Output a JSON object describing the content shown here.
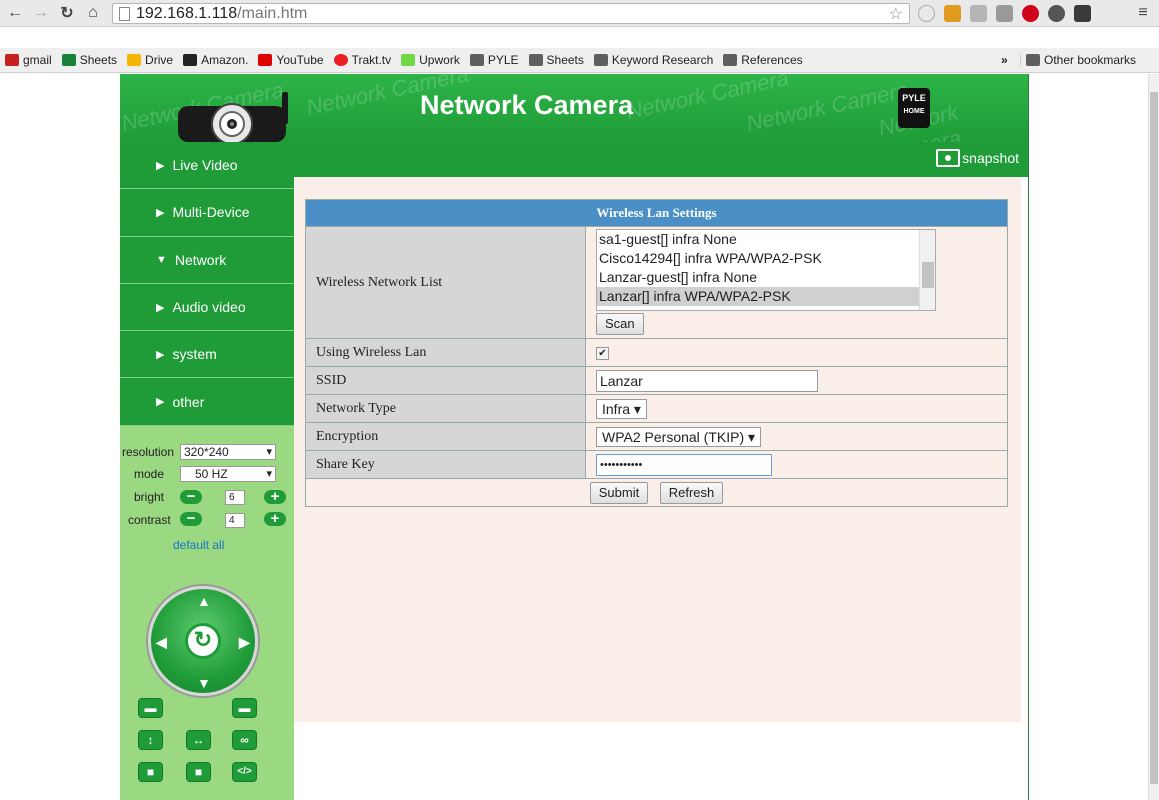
{
  "browser": {
    "url_host": "192.168.1.118",
    "url_path": "/main.htm",
    "bookmarks": [
      {
        "label": "gmail",
        "icon": "gmail-icon",
        "color": "#c5221f"
      },
      {
        "label": "Sheets",
        "icon": "sheets-icon",
        "color": "#188038"
      },
      {
        "label": "Drive",
        "icon": "drive-icon",
        "color": "#f4b400"
      },
      {
        "label": "Amazon.",
        "icon": "amazon-icon",
        "color": "#222222"
      },
      {
        "label": "YouTube",
        "icon": "youtube-icon",
        "color": "#e00000"
      },
      {
        "label": "Trakt.tv",
        "icon": "trakt-icon",
        "color": "#ed1c24"
      },
      {
        "label": "Upwork",
        "icon": "upwork-icon",
        "color": "#6fda44"
      },
      {
        "label": "PYLE",
        "icon": "folder-icon",
        "color": "#5f5f5f"
      },
      {
        "label": "Sheets",
        "icon": "folder-icon",
        "color": "#5f5f5f"
      },
      {
        "label": "Keyword Research",
        "icon": "folder-icon",
        "color": "#5f5f5f"
      },
      {
        "label": "References",
        "icon": "folder-icon",
        "color": "#5f5f5f"
      }
    ],
    "overflow": "»",
    "other_bookmarks": "Other bookmarks"
  },
  "banner": {
    "title": "Network Camera",
    "watermark": "Network Camera",
    "brand": "PYLE",
    "brand_sub": "HOME"
  },
  "menu": [
    {
      "label": "Live Video",
      "arrow": "▶"
    },
    {
      "label": "Multi-Device",
      "arrow": "▶"
    },
    {
      "label": "Network",
      "arrow": "▼"
    },
    {
      "label": "Audio video",
      "arrow": "▶"
    },
    {
      "label": "system",
      "arrow": "▶"
    },
    {
      "label": "other",
      "arrow": "▶"
    }
  ],
  "snapshot_label": "snapshot",
  "controls": {
    "resolution_label": "resolution",
    "resolution_value": "320*240",
    "mode_label": "mode",
    "mode_value": "50 HZ",
    "bright_label": "bright",
    "bright_value": "6",
    "contrast_label": "contrast",
    "contrast_value": "4",
    "default_all": "default all"
  },
  "wifi": {
    "header": "Wireless Lan Settings",
    "network_list_label": "Wireless Network List",
    "networks": [
      "sa1-guest[] infra None",
      "Cisco14294[] infra WPA/WPA2-PSK",
      "Lanzar-guest[] infra None",
      "Lanzar[] infra WPA/WPA2-PSK"
    ],
    "selected_network_index": 3,
    "scan_label": "Scan",
    "using_label": "Using Wireless Lan",
    "using_checked": "✔",
    "ssid_label": "SSID",
    "ssid_value": "Lanzar",
    "network_type_label": "Network Type",
    "network_type_value": "Infra",
    "encryption_label": "Encryption",
    "encryption_value": "WPA2 Personal (TKIP)",
    "share_key_label": "Share Key",
    "share_key_value": "•••••••••••",
    "submit_label": "Submit",
    "refresh_label": "Refresh"
  },
  "colors": {
    "brand_green": "#1f9c38",
    "sidebar_green": "#9bd882",
    "header_blue": "#4a8fc5",
    "content_bg": "#f9efe8"
  }
}
